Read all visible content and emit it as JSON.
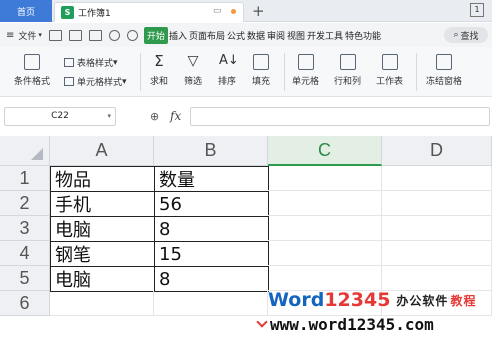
{
  "titlebar": {
    "home_tab": "首页",
    "doc_tab_logo": "S",
    "doc_tab": "工作簿1",
    "monitor_icon": "monitor-icon",
    "add_tab": "+",
    "window_badge": "1"
  },
  "menubar": {
    "hamburger": "≡",
    "file": "文件",
    "tabs": [
      "开始",
      "插入",
      "页面布局",
      "公式",
      "数据",
      "审阅",
      "视图",
      "开发工具",
      "特色功能"
    ],
    "active_tab": "开始",
    "search": "查找"
  },
  "ribbon": {
    "conditional_format": "条件格式",
    "table_style": "表格样式",
    "cell_style": "单元格样式",
    "sum": "求和",
    "filter": "筛选",
    "sort": "排序",
    "fill": "填充",
    "cell": "单元格",
    "rows_cols": "行和列",
    "worksheet": "工作表",
    "freeze": "冻结窗格"
  },
  "formulabar": {
    "name_box": "C22",
    "fx": "fx",
    "formula": ""
  },
  "grid": {
    "columns": [
      "A",
      "B",
      "C",
      "D"
    ],
    "selected_column": "C",
    "rows": [
      "1",
      "2",
      "3",
      "4",
      "5",
      "6"
    ],
    "cells": [
      [
        "物品",
        "数量"
      ],
      [
        "手机",
        "56"
      ],
      [
        "电脑",
        "8"
      ],
      [
        "钢笔",
        "15"
      ],
      [
        "电脑",
        "8"
      ],
      [
        "",
        ""
      ]
    ]
  },
  "watermark": {
    "brand_word": "Word",
    "brand_num": "12345",
    "slogan_a": "办公软件",
    "slogan_b": "教程",
    "url": "www.word12345.com"
  },
  "colors": {
    "accent_green": "#2f9a4d",
    "home_tab_blue": "#3e7bd8",
    "brand_blue": "#1565c0",
    "brand_red": "#e53935"
  }
}
